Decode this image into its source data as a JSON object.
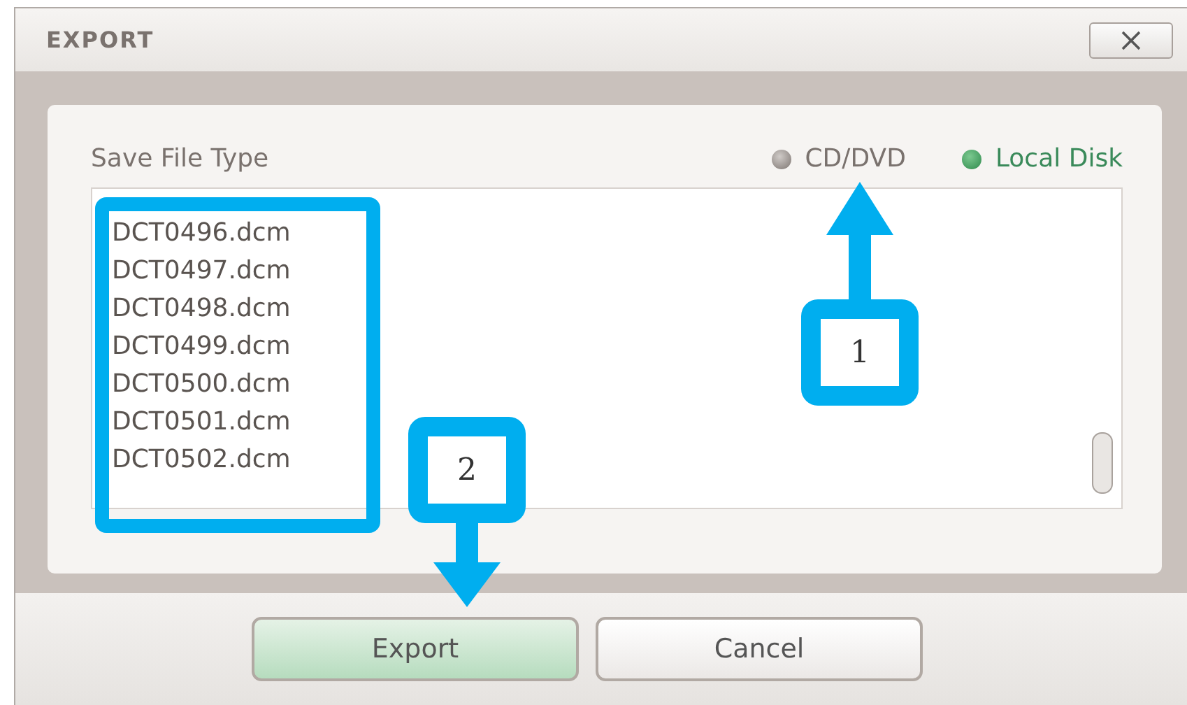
{
  "window": {
    "title": "EXPORT"
  },
  "save_file_type": {
    "label": "Save File Type",
    "options": [
      {
        "label": "CD/DVD",
        "selected": false
      },
      {
        "label": "Local Disk",
        "selected": true
      }
    ]
  },
  "files": [
    "DCT0496.dcm",
    "DCT0497.dcm",
    "DCT0498.dcm",
    "DCT0499.dcm",
    "DCT0500.dcm",
    "DCT0501.dcm",
    "DCT0502.dcm"
  ],
  "buttons": [
    {
      "label": "Export",
      "kind": "primary"
    },
    {
      "label": "Cancel",
      "kind": "secondary"
    }
  ],
  "callouts": [
    {
      "label": "1",
      "kind": "up"
    },
    {
      "label": "2",
      "kind": "down"
    }
  ]
}
